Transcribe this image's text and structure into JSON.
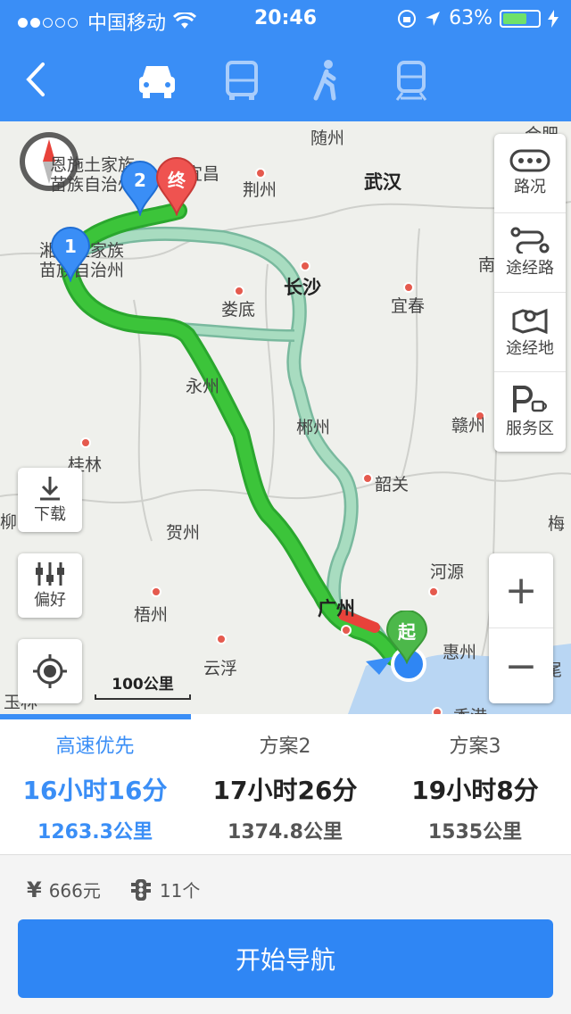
{
  "status": {
    "carrier": "中国移动",
    "time": "20:46",
    "battery": "63%"
  },
  "nav": {
    "modes": [
      "car-icon",
      "bus-icon",
      "walk-icon",
      "train-icon"
    ],
    "active_mode": "car-icon"
  },
  "map": {
    "cities": [
      {
        "name": "随州",
        "big": false
      },
      {
        "name": "恩施土家族苗族自治州",
        "big": false
      },
      {
        "name": "宜昌",
        "big": false
      },
      {
        "name": "荆州",
        "big": false
      },
      {
        "name": "武汉",
        "big": true
      },
      {
        "name": "湘西土家族苗族自治州",
        "big": false
      },
      {
        "name": "长沙",
        "big": true
      },
      {
        "name": "娄底",
        "big": false
      },
      {
        "name": "宜春",
        "big": false
      },
      {
        "name": "永州",
        "big": false
      },
      {
        "name": "郴州",
        "big": false
      },
      {
        "name": "赣州",
        "big": false
      },
      {
        "name": "桂林",
        "big": false
      },
      {
        "name": "韶关",
        "big": false
      },
      {
        "name": "贺州",
        "big": false
      },
      {
        "name": "河源",
        "big": false
      },
      {
        "name": "梧州",
        "big": false
      },
      {
        "name": "广州",
        "big": true
      },
      {
        "name": "惠州",
        "big": false
      },
      {
        "name": "云浮",
        "big": false
      },
      {
        "name": "香港",
        "big": false
      },
      {
        "name": "合肥",
        "big": false
      },
      {
        "name": "南",
        "big": false
      },
      {
        "name": "梅",
        "big": false
      },
      {
        "name": "柳",
        "big": false
      },
      {
        "name": "玉林",
        "big": false
      },
      {
        "name": "汕尾",
        "big": false
      }
    ],
    "pins": {
      "waypoint1": "1",
      "waypoint2": "2",
      "end": "终",
      "start": "起"
    },
    "side_panel": [
      {
        "label": "路况",
        "icon": "traffic-icon"
      },
      {
        "label": "途经路",
        "icon": "route-via-icon"
      },
      {
        "label": "途经地",
        "icon": "map-pin-icon"
      },
      {
        "label": "服务区",
        "icon": "service-area-icon"
      }
    ],
    "download_label": "下载",
    "preference_label": "偏好",
    "scale_label": "100公里",
    "zoom_in": "+",
    "zoom_out": "−"
  },
  "routes": [
    {
      "name": "高速优先",
      "duration": "16小时16分",
      "distance": "1263.3公里",
      "active": true
    },
    {
      "name": "方案2",
      "duration": "17小时26分",
      "distance": "1374.8公里",
      "active": false
    },
    {
      "name": "方案3",
      "duration": "19小时8分",
      "distance": "1535公里",
      "active": false
    }
  ],
  "info": {
    "toll": "666元",
    "traffic_lights": "11个"
  },
  "start_button": "开始导航",
  "colors": {
    "accent": "#3a8ef6",
    "route_primary": "#3cc43a",
    "route_alt": "#a8dcc0"
  }
}
